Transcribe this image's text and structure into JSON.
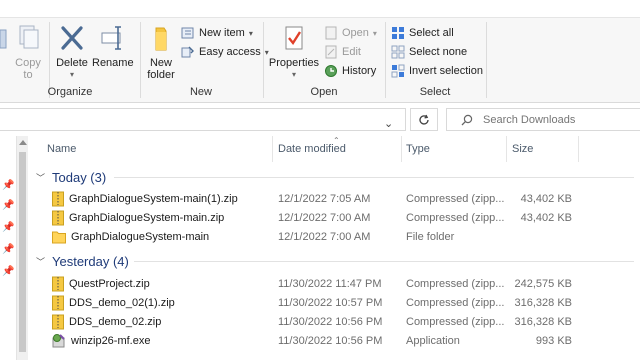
{
  "ribbon": {
    "copy_to": "Copy\nto",
    "copy_to_line1": "Copy",
    "copy_to_line2": "to",
    "delete": "Delete",
    "rename": "Rename",
    "new_folder_line1": "New",
    "new_folder_line2": "folder",
    "new_item": "New item",
    "easy_access": "Easy access",
    "properties": "Properties",
    "open": "Open",
    "edit": "Edit",
    "history": "History",
    "select_all": "Select all",
    "select_none": "Select none",
    "invert_selection": "Invert selection",
    "groups": {
      "organize": "Organize",
      "new": "New",
      "open": "Open",
      "select": "Select"
    }
  },
  "search": {
    "placeholder": "Search Downloads"
  },
  "columns": {
    "name": "Name",
    "date": "Date modified",
    "type": "Type",
    "size": "Size"
  },
  "groups": [
    {
      "label": "Today (3)",
      "files": [
        {
          "name": "GraphDialogueSystem-main(1).zip",
          "date": "12/1/2022 7:05 AM",
          "type": "Compressed (zipp...",
          "size": "43,402 KB",
          "icon": "zip-icon"
        },
        {
          "name": "GraphDialogueSystem-main.zip",
          "date": "12/1/2022 7:00 AM",
          "type": "Compressed (zipp...",
          "size": "43,402 KB",
          "icon": "zip-icon"
        },
        {
          "name": "GraphDialogueSystem-main",
          "date": "12/1/2022 7:00 AM",
          "type": "File folder",
          "size": "",
          "icon": "folder-icon"
        }
      ]
    },
    {
      "label": "Yesterday (4)",
      "files": [
        {
          "name": "QuestProject.zip",
          "date": "11/30/2022 11:47 PM",
          "type": "Compressed (zipp...",
          "size": "242,575 KB",
          "icon": "zip-icon"
        },
        {
          "name": "DDS_demo_02(1).zip",
          "date": "11/30/2022 10:57 PM",
          "type": "Compressed (zipp...",
          "size": "316,328 KB",
          "icon": "zip-icon"
        },
        {
          "name": "DDS_demo_02.zip",
          "date": "11/30/2022 10:56 PM",
          "type": "Compressed (zipp...",
          "size": "316,328 KB",
          "icon": "zip-icon"
        },
        {
          "name": "winzip26-mf.exe",
          "date": "11/30/2022 10:56 PM",
          "type": "Application",
          "size": "993 KB",
          "icon": "installer-icon"
        }
      ]
    }
  ]
}
